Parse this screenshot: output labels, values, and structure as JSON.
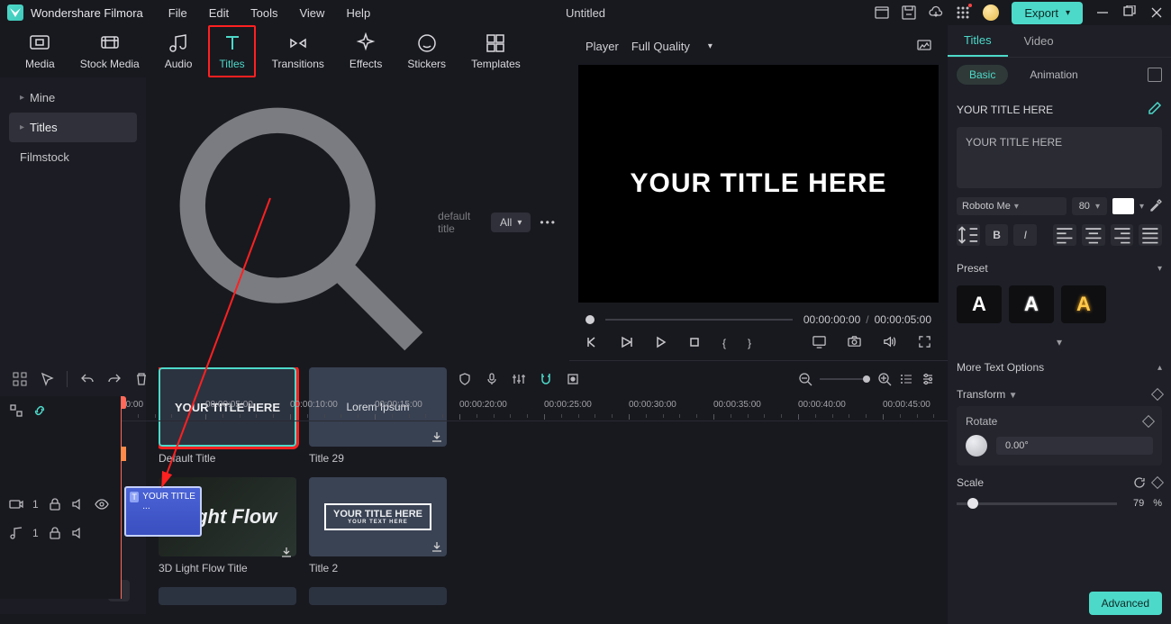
{
  "app_name": "Wondershare Filmora",
  "menu": [
    "File",
    "Edit",
    "Tools",
    "View",
    "Help"
  ],
  "doc_title": "Untitled",
  "export_label": "Export",
  "tabs": [
    {
      "label": "Media",
      "icon": "media"
    },
    {
      "label": "Stock Media",
      "icon": "stock"
    },
    {
      "label": "Audio",
      "icon": "audio"
    },
    {
      "label": "Titles",
      "icon": "titles"
    },
    {
      "label": "Transitions",
      "icon": "transitions"
    },
    {
      "label": "Effects",
      "icon": "effects"
    },
    {
      "label": "Stickers",
      "icon": "stickers"
    },
    {
      "label": "Templates",
      "icon": "templates"
    }
  ],
  "side_nav": {
    "items": [
      {
        "label": "Mine",
        "selected": false
      },
      {
        "label": "Titles",
        "selected": true
      },
      {
        "label": "Filmstock",
        "selected": false
      }
    ]
  },
  "search": {
    "placeholder": "default title",
    "filter": "All"
  },
  "assets": [
    {
      "label": "Default Title",
      "thumb_text": "YOUR TITLE HERE",
      "style": "sel"
    },
    {
      "label": "Title 29",
      "thumb_text": "Lorem Ipsum",
      "style": "t29",
      "downloadable": true
    },
    {
      "label": "3D Light Flow Title",
      "thumb_text": "Light Flow",
      "style": "lightflow",
      "downloadable": true
    },
    {
      "label": "Title 2",
      "thumb_text": "YOUR TITLE HERE",
      "thumb_sub": "YOUR TEXT HERE",
      "style": "t2",
      "downloadable": true
    }
  ],
  "preview": {
    "player_label": "Player",
    "quality": "Full Quality",
    "title_text": "YOUR TITLE HERE",
    "time_current": "00:00:00:00",
    "time_total": "00:00:05:00"
  },
  "right": {
    "tabs": [
      "Titles",
      "Video"
    ],
    "subtabs": [
      "Basic",
      "Animation"
    ],
    "section_title": "YOUR TITLE HERE",
    "textarea_value": "YOUR TITLE HERE",
    "font": "Roboto Me",
    "font_size": "80",
    "preset_label": "Preset",
    "more_text_label": "More Text Options",
    "transform_label": "Transform",
    "rotate_label": "Rotate",
    "rotate_value": "0.00°",
    "scale_label": "Scale",
    "scale_value": "79",
    "scale_unit": "%",
    "advanced_label": "Advanced"
  },
  "timeline": {
    "marks": [
      "00:00",
      "00:00:05:00",
      "00:00:10:00",
      "00:00:15:00",
      "00:00:20:00",
      "00:00:25:00",
      "00:00:30:00",
      "00:00:35:00",
      "00:00:40:00",
      "00:00:45:00"
    ],
    "clip_label": "YOUR TITLE ...",
    "video_track": "1",
    "audio_track": "1"
  }
}
